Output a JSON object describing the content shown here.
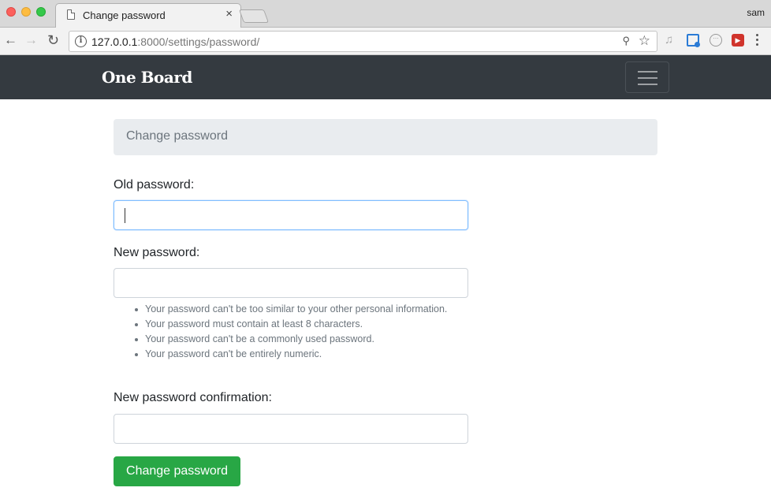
{
  "browser": {
    "tab_title": "Change password",
    "tab_close": "×",
    "user": "sam",
    "url_host": "127.0.0.1",
    "url_rest": ":8000/settings/password/",
    "back_glyph": "←",
    "forward_glyph": "→",
    "reload_glyph": "↻",
    "info_glyph": "i",
    "key_glyph": "⚲",
    "star_glyph": "☆",
    "icons": [
      "doc-icon",
      "info-icon",
      "key-icon",
      "star-icon",
      "music-icon",
      "cast-icon",
      "circle-extension-icon",
      "red-extension-icon",
      "menu-icon"
    ]
  },
  "navbar": {
    "brand": "One Board",
    "toggler_icon": "hamburger-icon"
  },
  "breadcrumb": {
    "current": "Change password"
  },
  "form": {
    "old_password_label": "Old password:",
    "new_password_label": "New password:",
    "help_items": [
      "Your password can't be too similar to your other personal information.",
      "Your password must contain at least 8 characters.",
      "Your password can't be a commonly used password.",
      "Your password can't be entirely numeric."
    ],
    "confirm_label": "New password confirmation:",
    "submit_label": "Change password"
  },
  "colors": {
    "navbar": "#343a40",
    "breadcrumb_bg": "#e9ecef",
    "muted": "#6c757d",
    "success": "#28a745",
    "focus_border": "#80bdff"
  }
}
